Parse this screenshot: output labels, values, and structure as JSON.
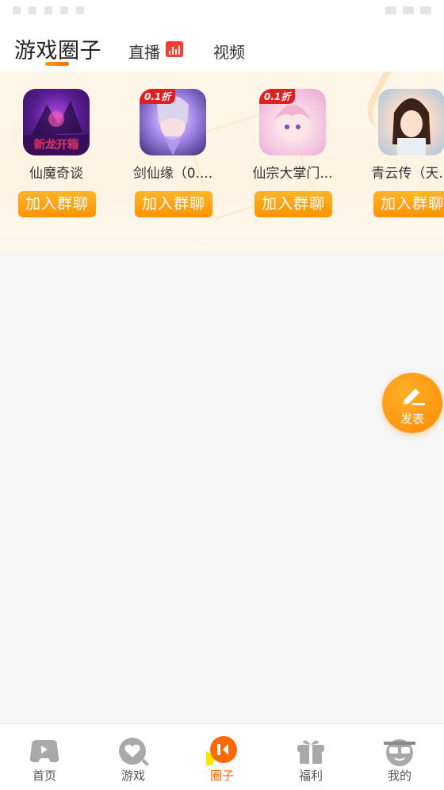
{
  "header": {
    "tabs": [
      {
        "label": "游戏圈子",
        "active": true
      },
      {
        "label": "直播",
        "badge": "live-icon"
      },
      {
        "label": "视频"
      }
    ]
  },
  "groups": [
    {
      "name": "仙魔奇谈",
      "icon": "xianmo-game-icon",
      "icon_caption": "新龙开箱",
      "button": "加入群聊"
    },
    {
      "name": "剑仙缘（0....",
      "icon": "jianxian-game-icon",
      "discount": "0.1折",
      "button": "加入群聊"
    },
    {
      "name": "仙宗大掌门...",
      "icon": "xianzong-game-icon",
      "discount": "0.1折",
      "button": "加入群聊"
    },
    {
      "name": "青云传（天...",
      "icon": "qingyun-game-icon",
      "button": "加入群聊"
    }
  ],
  "fab": {
    "label": "发表",
    "icon": "edit-icon"
  },
  "bottom_nav": [
    {
      "label": "首页",
      "icon": "gamepad-icon"
    },
    {
      "label": "游戏",
      "icon": "heart-search-icon"
    },
    {
      "label": "圈子",
      "icon": "circle-icon",
      "active": true
    },
    {
      "label": "福利",
      "icon": "gift-icon"
    },
    {
      "label": "我的",
      "icon": "face-glasses-icon"
    }
  ],
  "colors": {
    "accent": "#ff8a00",
    "active_tab": "#ff6a00",
    "live_badge": "#ff3b30",
    "discount": "#e02020"
  }
}
